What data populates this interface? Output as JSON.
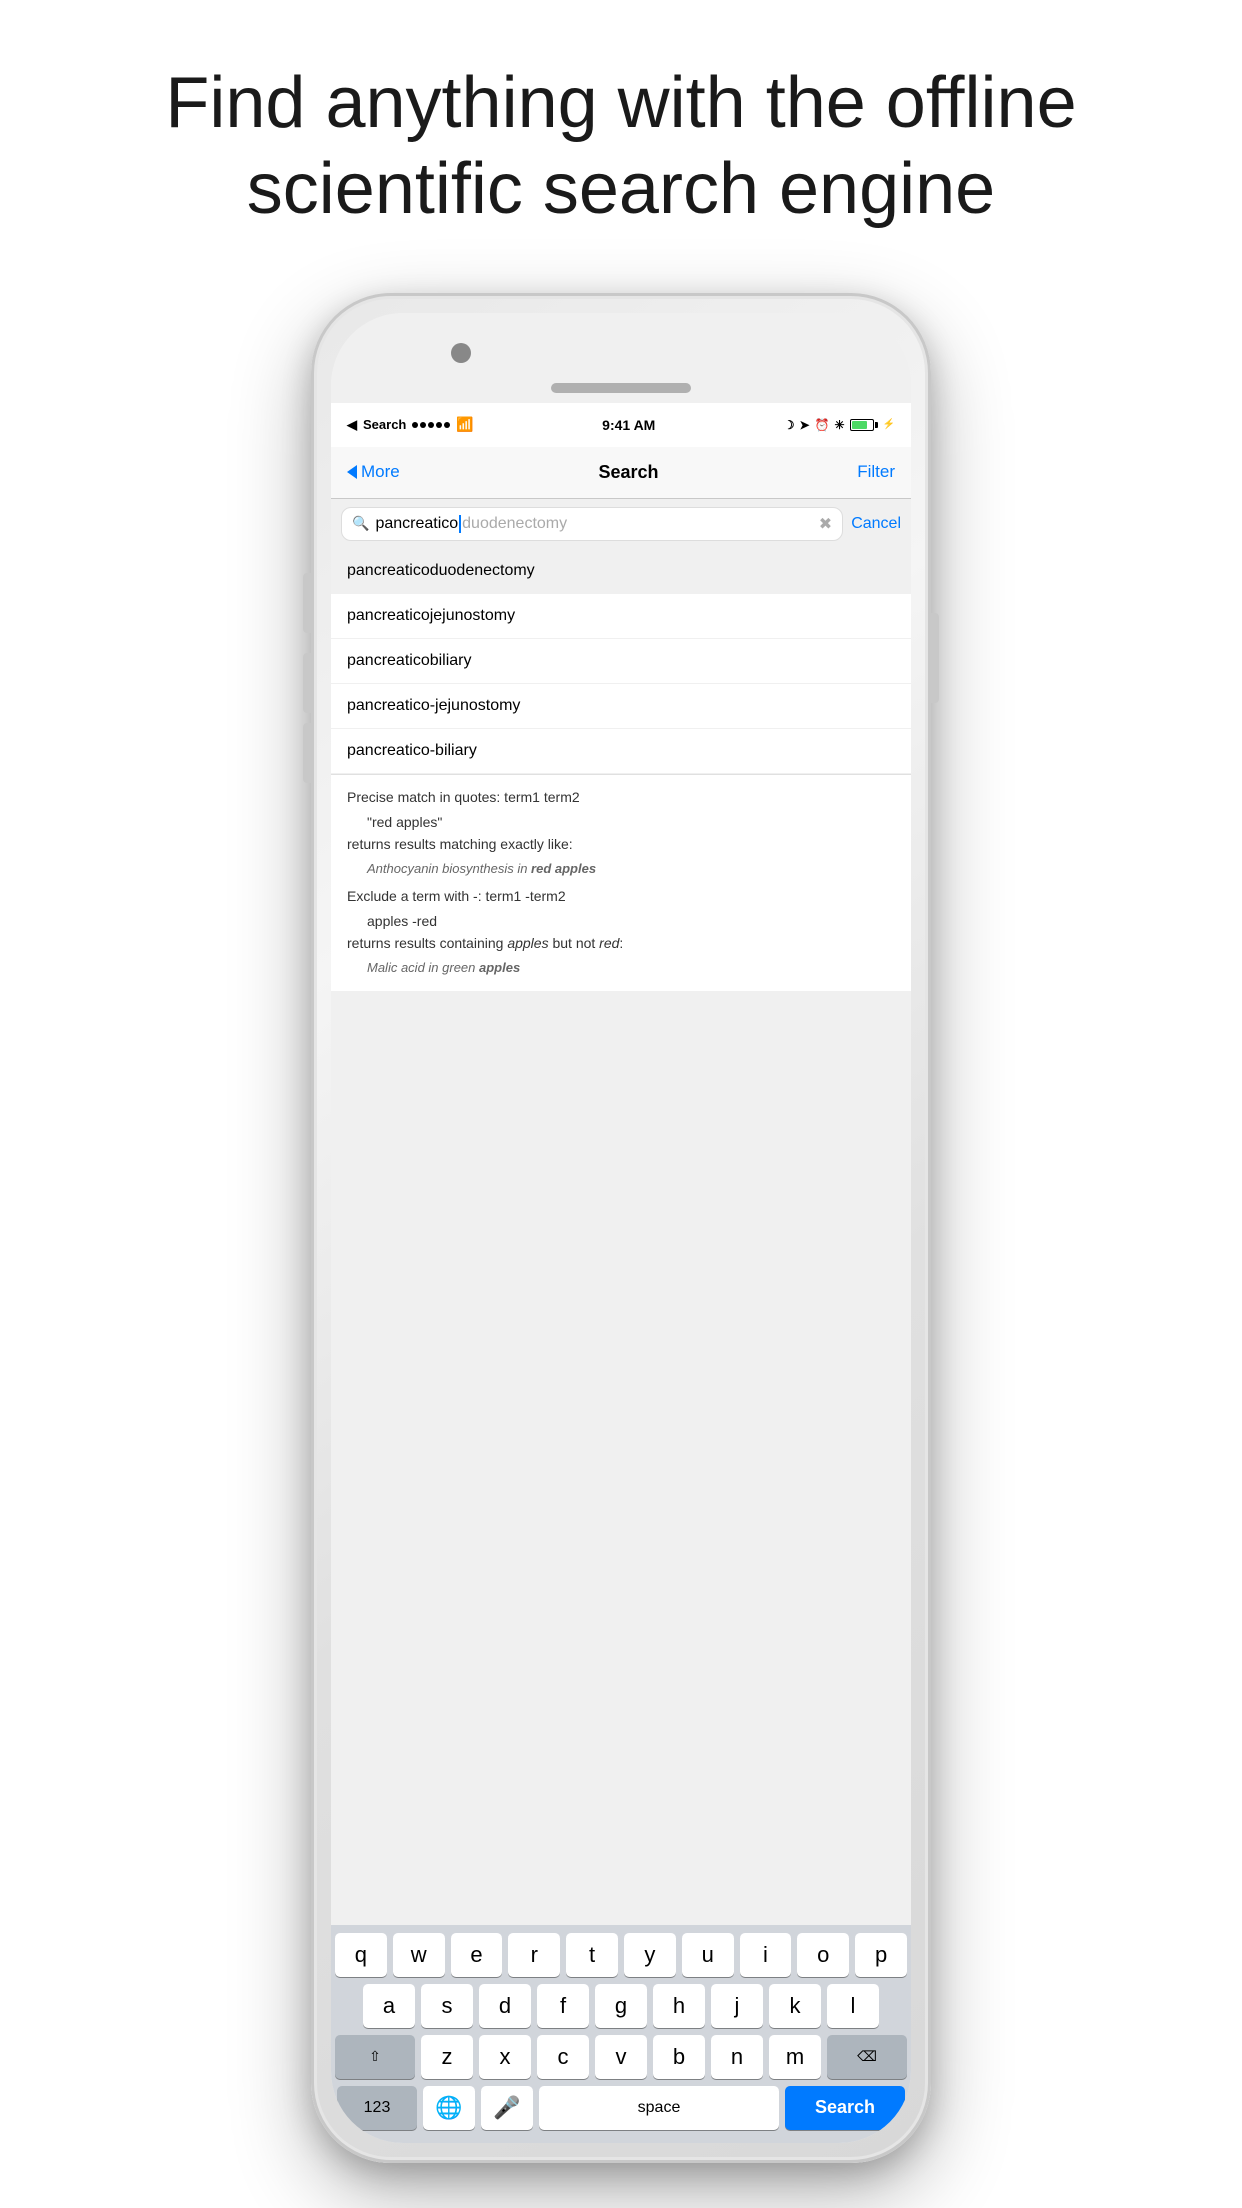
{
  "header": {
    "title": "Find anything with the offline scientific search engine"
  },
  "statusBar": {
    "carrier": "Search",
    "time": "9:41 AM",
    "battery_level": 70
  },
  "navbar": {
    "back_label": "More",
    "title": "Search",
    "filter_label": "Filter"
  },
  "searchBar": {
    "typed_text": "pancreatico",
    "autocomplete_text": "duodenectomy",
    "cancel_label": "Cancel"
  },
  "autocomplete": {
    "items": [
      {
        "label": "pancreaticoduodenectomy",
        "selected": true
      },
      {
        "label": "pancreaticojejunostomy",
        "selected": false
      },
      {
        "label": "pancreaticobiliary",
        "selected": false
      },
      {
        "label": "pancreatico-jejunostomy",
        "selected": false
      },
      {
        "label": "pancreatico-biliary",
        "selected": false
      }
    ]
  },
  "content": {
    "lines": [
      {
        "type": "heading",
        "text": "Precise match in quotes: term1 term2"
      },
      {
        "type": "indent",
        "text": "\"red apples\""
      },
      {
        "type": "normal",
        "text": "returns results matching exactly like:"
      },
      {
        "type": "example",
        "text": "Anthocyanin biosynthesis in red apples"
      },
      {
        "type": "heading",
        "text": "Exclude a term with -: term1 -term2"
      },
      {
        "type": "indent",
        "text": "apples -red"
      },
      {
        "type": "normal",
        "text": "returns results containing apples but not red:"
      },
      {
        "type": "example",
        "text": "Malic acid in green apples"
      }
    ]
  },
  "keyboard": {
    "rows": [
      [
        "q",
        "w",
        "e",
        "r",
        "t",
        "y",
        "u",
        "i",
        "o",
        "p"
      ],
      [
        "a",
        "s",
        "d",
        "f",
        "g",
        "h",
        "j",
        "k",
        "l"
      ],
      [
        "⇧",
        "z",
        "x",
        "c",
        "v",
        "b",
        "n",
        "m",
        "⌫"
      ],
      [
        "123",
        "🌐",
        "🎤",
        "space",
        "Search"
      ]
    ],
    "search_label": "Search",
    "space_label": "space",
    "nums_label": "123"
  }
}
